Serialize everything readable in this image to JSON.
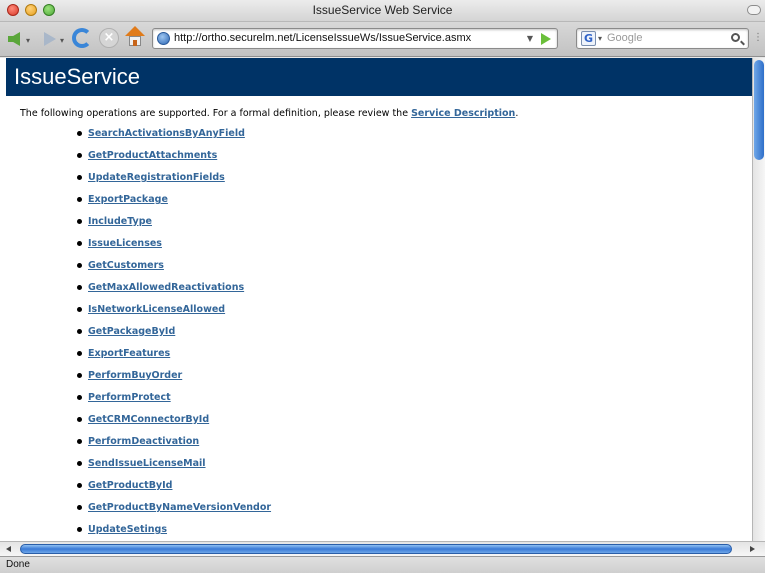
{
  "window": {
    "title": "IssueService Web Service"
  },
  "toolbar": {
    "url": "http://ortho.securelm.net/LicenseIssueWs/IssueService.asmx",
    "search_placeholder": "Google",
    "search_engine_letter": "G"
  },
  "page": {
    "heading": "IssueService",
    "intro_text": "The following operations are supported. For a formal definition, please review the ",
    "intro_link": "Service Description",
    "intro_end": ".",
    "operations": [
      "SearchActivationsByAnyField",
      "GetProductAttachments",
      "UpdateRegistrationFields",
      "ExportPackage",
      "IncludeType",
      "IssueLicenses",
      "GetCustomers",
      "GetMaxAllowedReactivations",
      "IsNetworkLicenseAllowed",
      "GetPackageById",
      "ExportFeatures",
      "PerformBuyOrder",
      "PerformProtect",
      "GetCRMConnectorById",
      "PerformDeactivation",
      "SendIssueLicenseMail",
      "GetProductById",
      "GetProductByNameVersionVendor",
      "UpdateSetings"
    ]
  },
  "status": {
    "text": "Done"
  },
  "colors": {
    "header_band": "#003366",
    "link": "#336699"
  }
}
